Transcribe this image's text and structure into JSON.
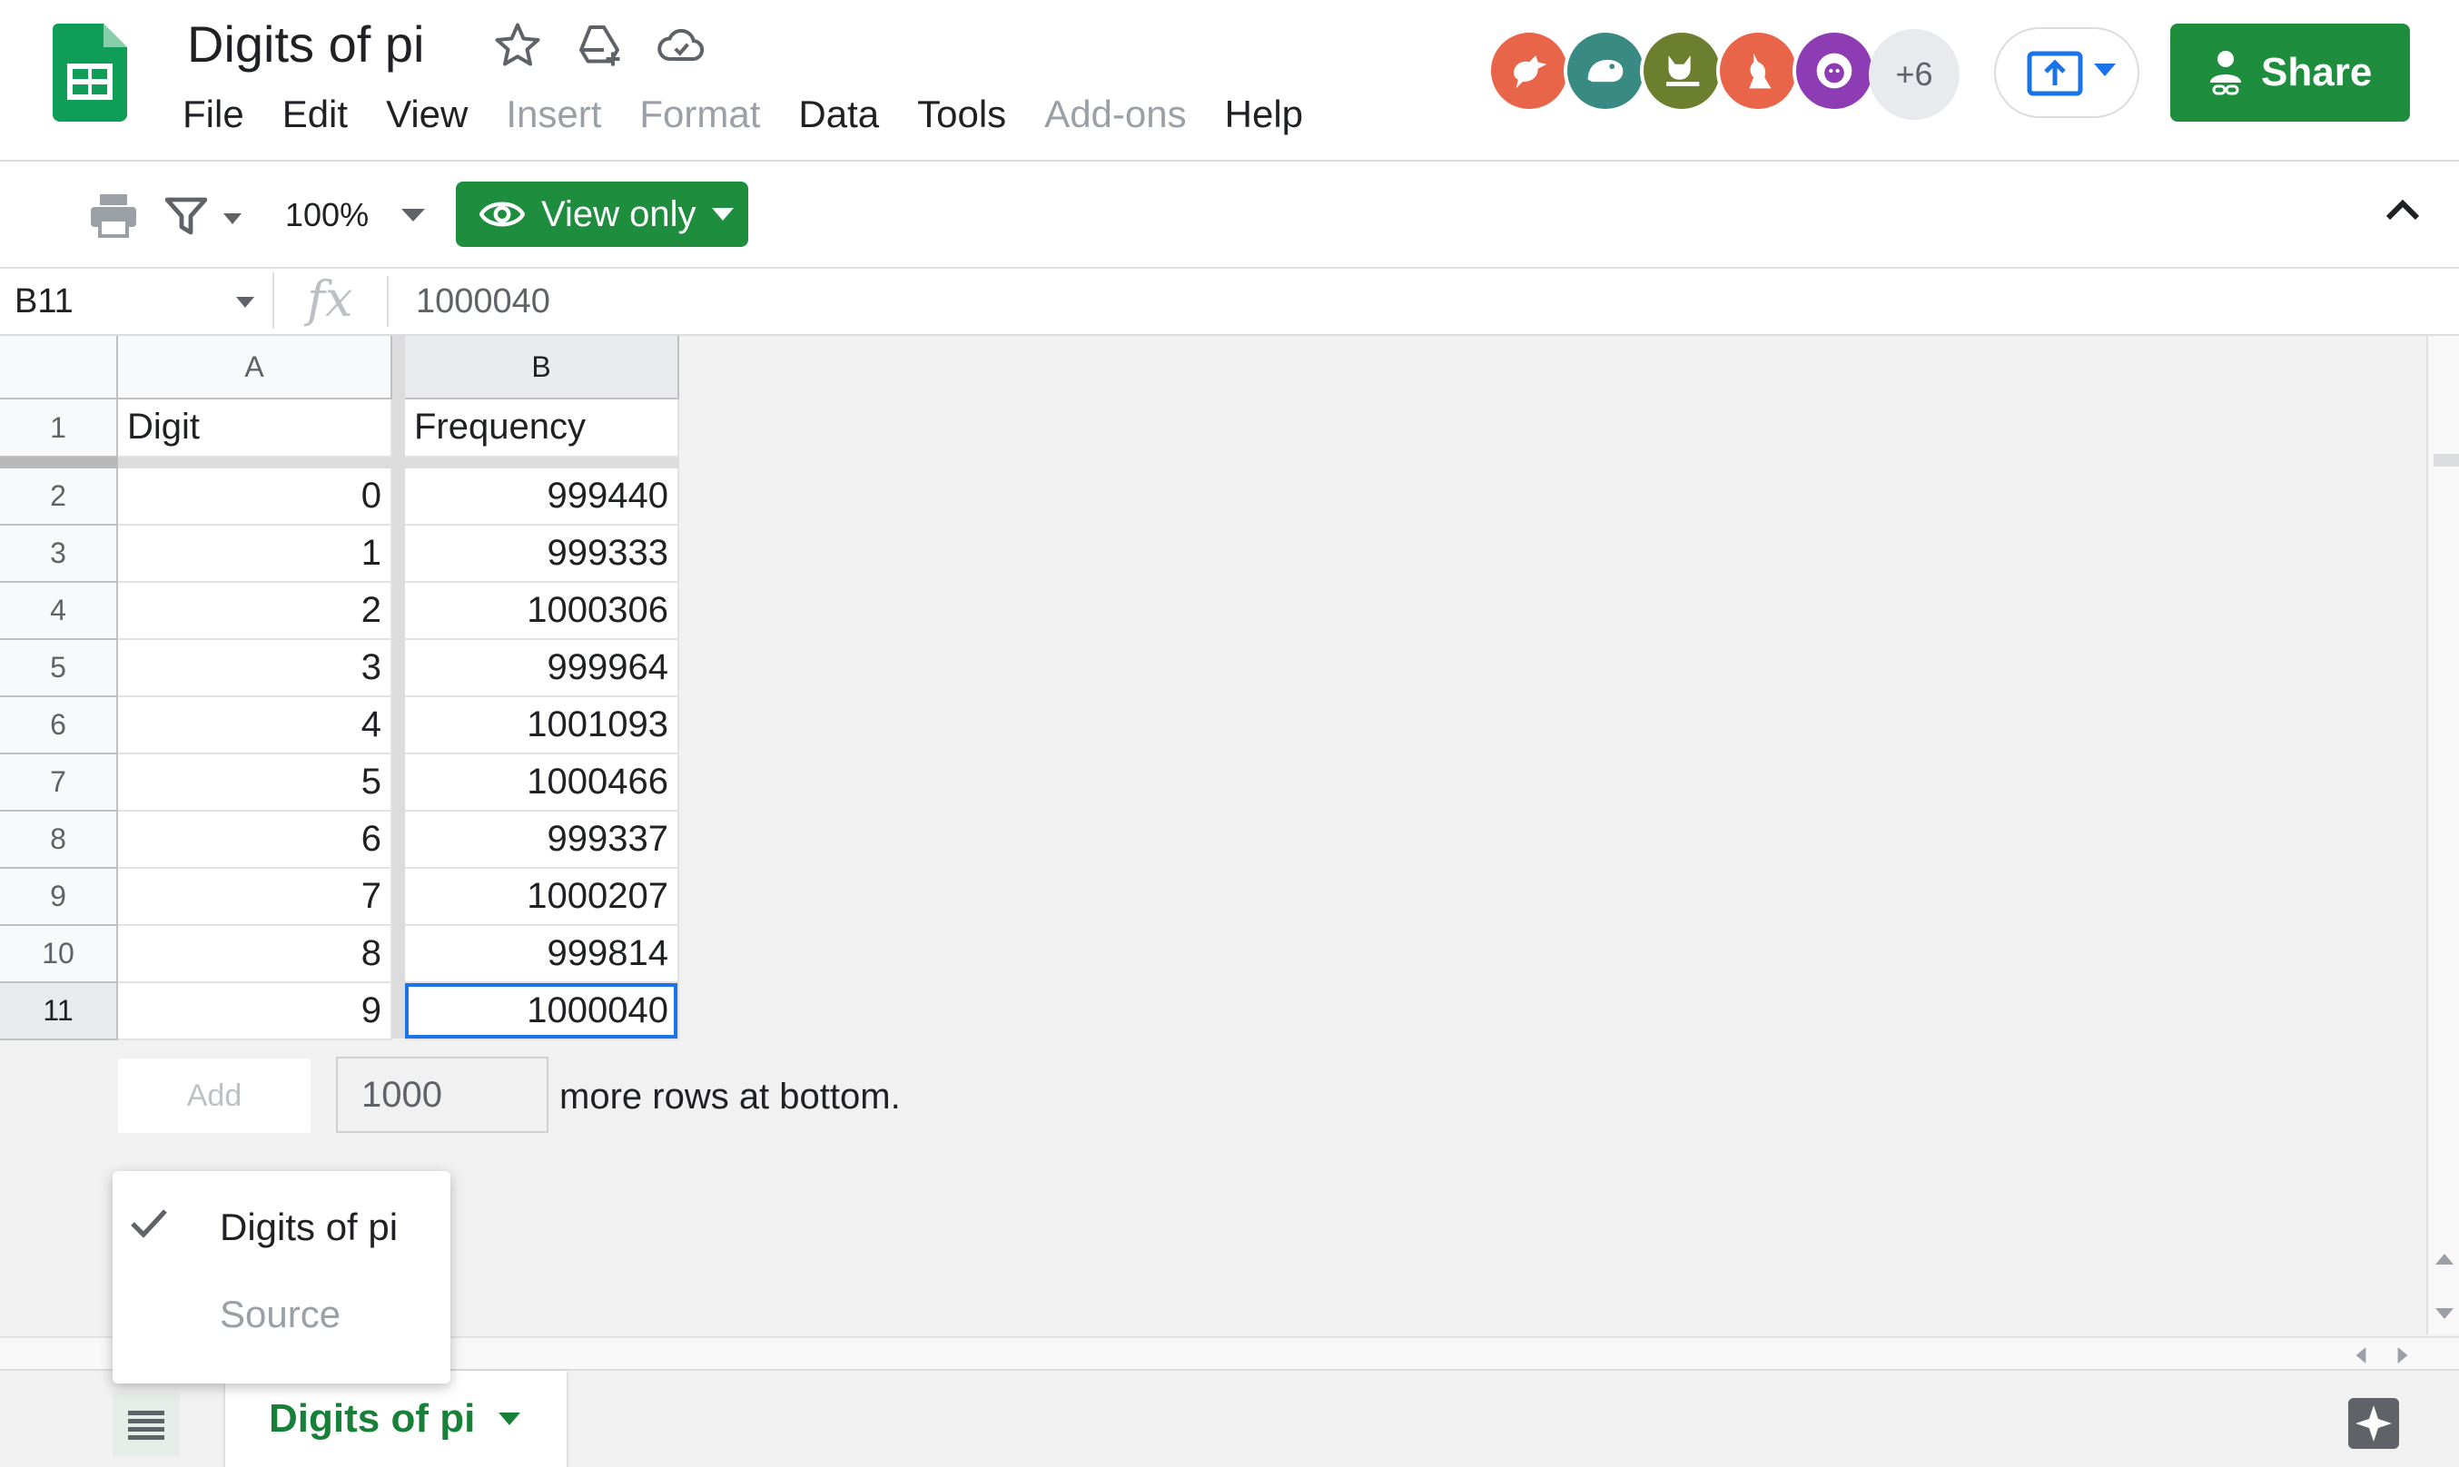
{
  "app": {
    "doc_title": "Digits of pi",
    "menu": [
      "File",
      "Edit",
      "View",
      "Insert",
      "Format",
      "Data",
      "Tools",
      "Add-ons",
      "Help"
    ],
    "menu_disabled": [
      false,
      false,
      false,
      true,
      true,
      false,
      false,
      true,
      false
    ],
    "collaborators": [
      {
        "icon": "bird-avatar-icon",
        "color": "#e8654a"
      },
      {
        "icon": "hippo-avatar-icon",
        "color": "#3a8a84"
      },
      {
        "icon": "fox-avatar-icon",
        "color": "#6b7f2e"
      },
      {
        "icon": "kangaroo-avatar-icon",
        "color": "#e8654a"
      },
      {
        "icon": "lion-avatar-icon",
        "color": "#8e3cb3"
      }
    ],
    "collaborators_more": "+6",
    "share_label": "Share"
  },
  "toolbar": {
    "zoom": "100%",
    "view_only_label": "View only"
  },
  "formula_bar": {
    "cell_ref": "B11",
    "fx": "fx",
    "value": "1000040"
  },
  "sheet": {
    "columns": [
      "A",
      "B"
    ],
    "selected_column": "B",
    "header_row": {
      "row_number": "1",
      "a": "Digit",
      "b": "Frequency"
    },
    "rows": [
      {
        "row_number": "2",
        "a": "0",
        "b": "999440"
      },
      {
        "row_number": "3",
        "a": "1",
        "b": "999333"
      },
      {
        "row_number": "4",
        "a": "2",
        "b": "1000306"
      },
      {
        "row_number": "5",
        "a": "3",
        "b": "999964"
      },
      {
        "row_number": "6",
        "a": "4",
        "b": "1001093"
      },
      {
        "row_number": "7",
        "a": "5",
        "b": "1000466"
      },
      {
        "row_number": "8",
        "a": "6",
        "b": "999337"
      },
      {
        "row_number": "9",
        "a": "7",
        "b": "1000207"
      },
      {
        "row_number": "10",
        "a": "8",
        "b": "999814"
      },
      {
        "row_number": "11",
        "a": "9",
        "b": "1000040"
      }
    ],
    "selected_row_number": "11"
  },
  "add_rows": {
    "button_label": "Add",
    "count": "1000",
    "suffix": "more rows at bottom."
  },
  "sheet_menu": {
    "items": [
      {
        "label": "Digits of pi",
        "checked": true
      },
      {
        "label": "Source",
        "checked": false
      }
    ]
  },
  "tabs": {
    "active_label": "Digits of pi"
  },
  "colors": {
    "brand_green": "#1e8e3e",
    "sheets_green": "#0f9d58",
    "selection_blue": "#1a73e8"
  }
}
